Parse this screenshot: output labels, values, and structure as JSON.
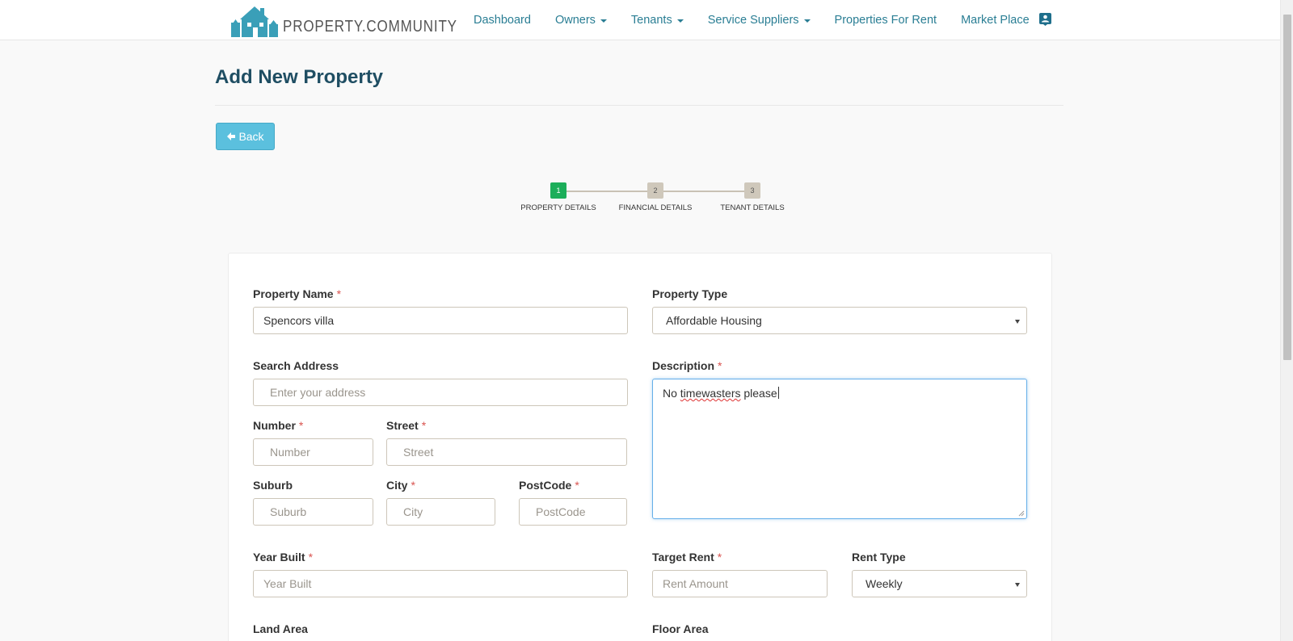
{
  "brand": {
    "name": "PROPERTY.COMMUNITY",
    "color": "#3a9fb8"
  },
  "nav": {
    "items": [
      {
        "label": "Dashboard",
        "dropdown": false
      },
      {
        "label": "Owners",
        "dropdown": true
      },
      {
        "label": "Tenants",
        "dropdown": true
      },
      {
        "label": "Service Suppliers",
        "dropdown": true
      },
      {
        "label": "Properties For Rent",
        "dropdown": false
      },
      {
        "label": "Market Place",
        "dropdown": false
      }
    ],
    "profile_icon": "contact-card-icon"
  },
  "page": {
    "title": "Add New Property",
    "back_label": "Back"
  },
  "stepper": {
    "current": 1,
    "steps": [
      {
        "number": "1",
        "label": "PROPERTY DETAILS"
      },
      {
        "number": "2",
        "label": "FINANCIAL DETAILS"
      },
      {
        "number": "3",
        "label": "TENANT DETAILS"
      }
    ]
  },
  "form": {
    "property_name": {
      "label": "Property Name",
      "required": "*",
      "value": "Spencors villa"
    },
    "property_type": {
      "label": "Property Type",
      "value": "Affordable Housing"
    },
    "search_address": {
      "label": "Search Address",
      "placeholder": "Enter your address"
    },
    "description": {
      "label": "Description",
      "required": "*",
      "value_prefix": "No ",
      "value_misspelled": "timewasters",
      "value_suffix": " please"
    },
    "number": {
      "label": "Number",
      "required": "*",
      "placeholder": "Number"
    },
    "street": {
      "label": "Street",
      "required": "*",
      "placeholder": "Street"
    },
    "suburb": {
      "label": "Suburb",
      "placeholder": "Suburb"
    },
    "city": {
      "label": "City",
      "required": "*",
      "placeholder": "City"
    },
    "postcode": {
      "label": "PostCode",
      "required": "*",
      "placeholder": "PostCode"
    },
    "year_built": {
      "label": "Year Built",
      "required": "*",
      "placeholder": "Year Built"
    },
    "target_rent": {
      "label": "Target Rent",
      "required": "*",
      "placeholder": "Rent Amount"
    },
    "rent_type": {
      "label": "Rent Type",
      "value": "Weekly"
    },
    "land_area": {
      "label": "Land Area"
    },
    "floor_area": {
      "label": "Floor Area"
    }
  },
  "colors": {
    "title": "#1f4e63",
    "link": "#2a7e94",
    "back_button": "#5bc0de",
    "step_active": "#1cae5a",
    "step_inactive": "#cfc8bb",
    "required": "#d9534f",
    "focus_border": "#66afe9"
  }
}
